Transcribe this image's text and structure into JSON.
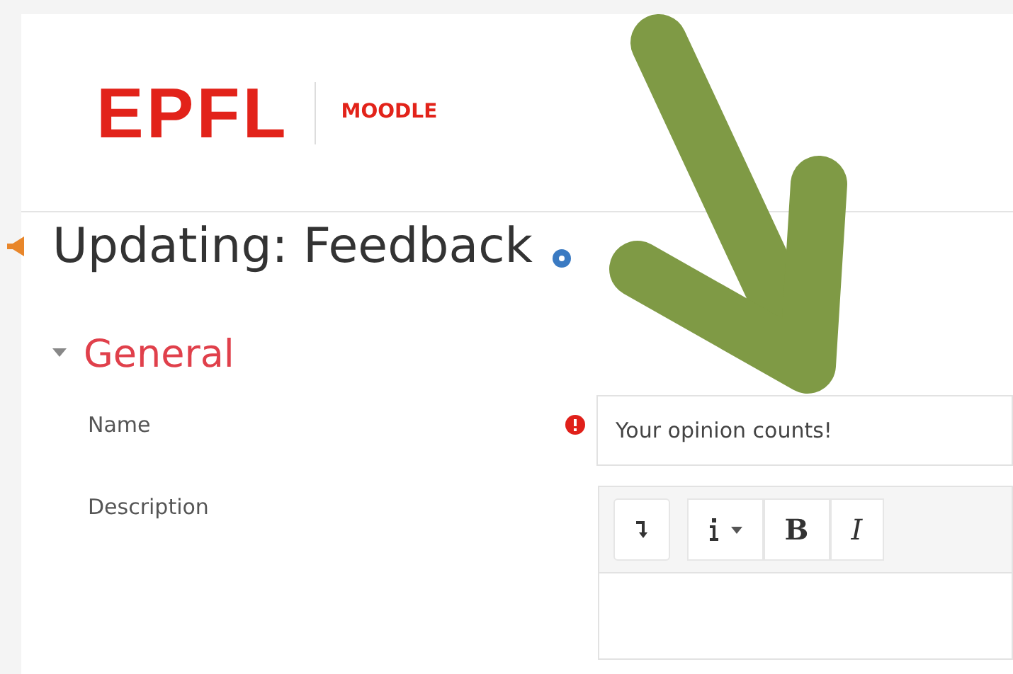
{
  "header": {
    "logo": "EPFL",
    "product": "MOODLE"
  },
  "page_title": "Updating: Feedback",
  "section": {
    "title": "General",
    "expanded": true
  },
  "fields": [
    {
      "kind": "text",
      "label": "Name",
      "required": true,
      "value": "Your opinion counts!"
    },
    {
      "kind": "editor",
      "label": "Description",
      "required": false,
      "toolbar": [
        "B",
        "I"
      ]
    }
  ]
}
